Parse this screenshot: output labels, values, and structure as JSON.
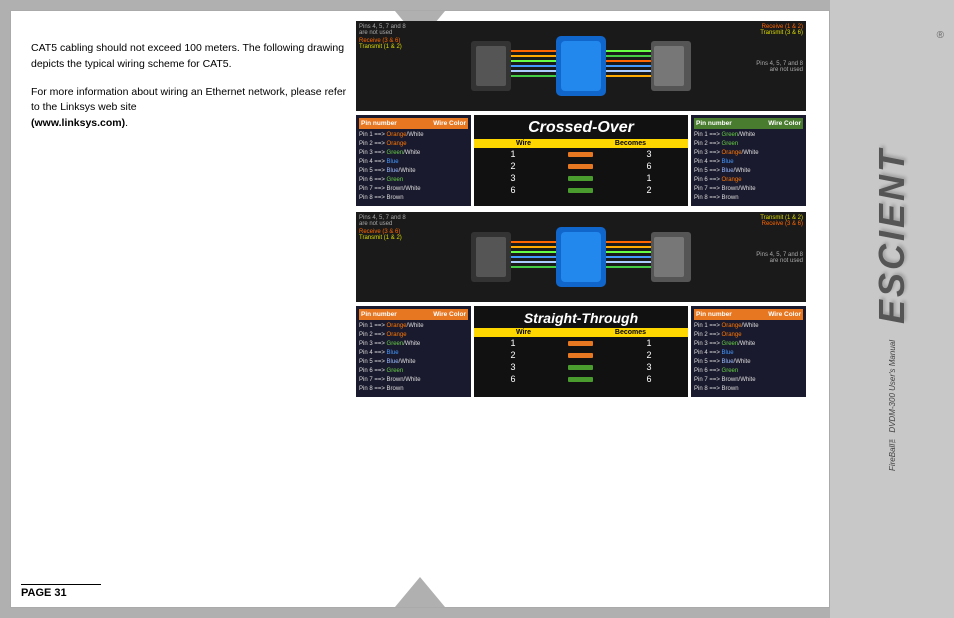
{
  "page": {
    "number": "PAGE 31",
    "background": "#b0b0b0"
  },
  "sidebar": {
    "logo": "ESCIENT",
    "registered": "®",
    "subtitle": "FireBall™ DVDM-300 User's Manual"
  },
  "left_text": {
    "paragraph1": "CAT5 cabling should not exceed 100 meters. The following drawing depicts the typical wiring scheme for CAT5.",
    "paragraph2": "For more information about wiring an Ethernet network, please refer to the Linksys web site (www.linksys.com)."
  },
  "crossover": {
    "title": "Crossed-Over",
    "header_wire": "Wire",
    "header_becomes": "Becomes",
    "rows": [
      {
        "wire": "1",
        "becomes": "3",
        "arrow": "orange"
      },
      {
        "wire": "2",
        "becomes": "6",
        "arrow": "orange"
      },
      {
        "wire": "3",
        "becomes": "1",
        "arrow": "green"
      },
      {
        "wire": "6",
        "becomes": "2",
        "arrow": "green"
      }
    ]
  },
  "straight_through": {
    "title": "Straight-Through",
    "header_wire": "Wire",
    "header_becomes": "Becomes",
    "rows": [
      {
        "wire": "1",
        "becomes": "1",
        "arrow": "orange"
      },
      {
        "wire": "2",
        "becomes": "2",
        "arrow": "orange"
      },
      {
        "wire": "3",
        "becomes": "3",
        "arrow": "green"
      },
      {
        "wire": "6",
        "becomes": "6",
        "arrow": "green"
      }
    ]
  },
  "pin_tables": {
    "left_orange_header": "Pin number   Wire Color",
    "left_green_header": "Pin number   Wire Color",
    "right_orange_header": "Pin number   Wire Color",
    "right_green_header": "Pin number   Wire Color",
    "pins_left": [
      "Pin 1 ==> Orange/White",
      "Pin 2 ==> Orange",
      "Pin 3 ==> Green/White",
      "Pin 4 ==> Blue",
      "Pin 5 ==> Blue/White",
      "Pin 6 ==> Green",
      "Pin 7 ==> Brown/White",
      "Pin 8 ==> Brown"
    ],
    "pins_right_crossover": [
      "Pin 1 ==> Green/White",
      "Pin 2 ==> Green",
      "Pin 3 ==> Orange/White",
      "Pin 4 ==> Blue",
      "Pin 5 ==> Blue/White",
      "Pin 6 ==> Orange",
      "Pin 7 ==> Brown/White",
      "Pin 8 ==> Brown"
    ],
    "pins_right_straight": [
      "Pin 1 ==> Orange/White",
      "Pin 2 ==> Orange",
      "Pin 3 ==> Green/White",
      "Pin 4 ==> Blue",
      "Pin 5 ==> Blue/White",
      "Pin 6 ==> Green",
      "Pin 7 ==> Brown/White",
      "Pin 8 ==> Brown"
    ]
  }
}
